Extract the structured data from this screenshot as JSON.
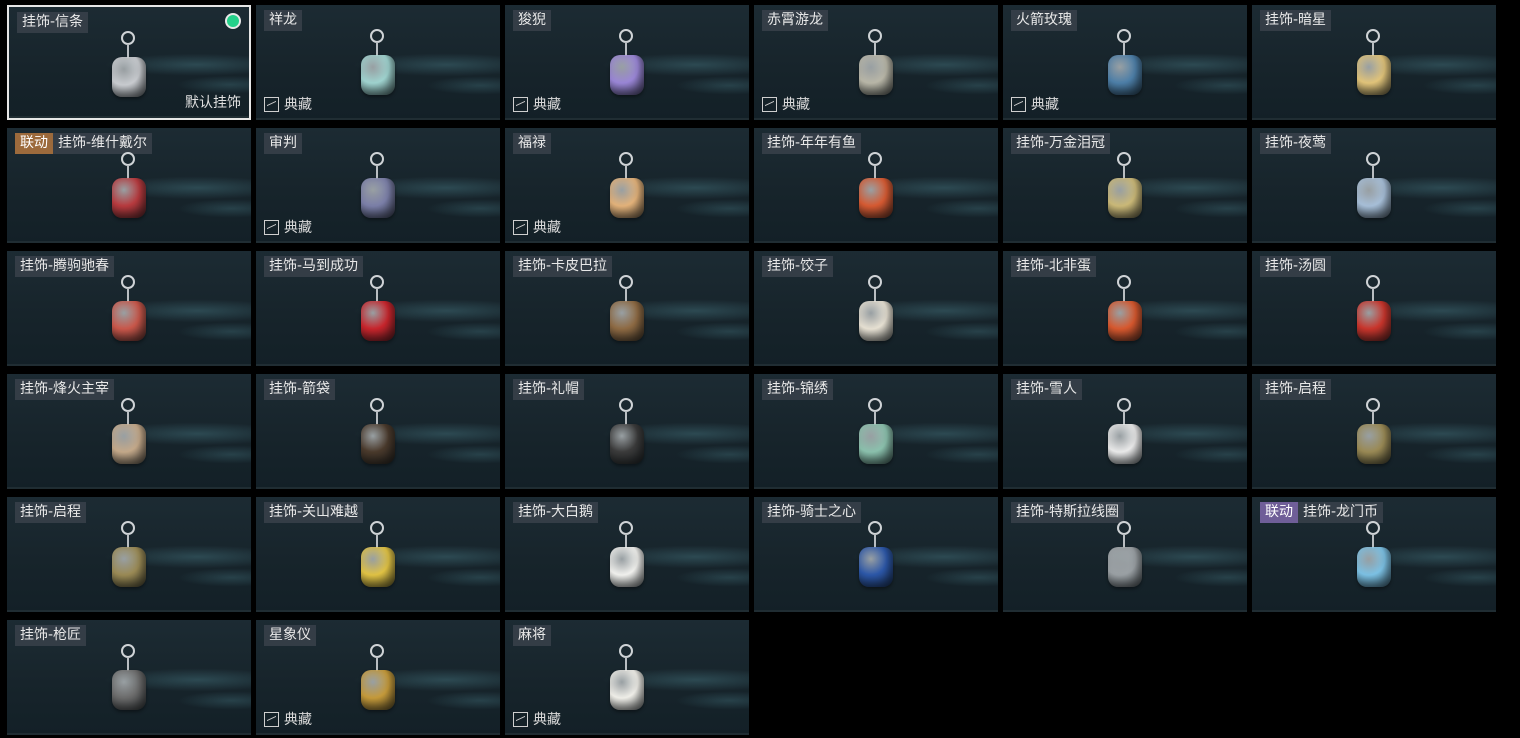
{
  "screen": {
    "collection_label": "典藏",
    "default_label": "默认挂饰"
  },
  "rows": [
    [
      {
        "name": "挂饰-信条",
        "selected": true,
        "equipped": true,
        "default": true,
        "collection": false,
        "color": "#c9ccd0",
        "icon": "creed-charm-icon"
      },
      {
        "name": "祥龙",
        "collection": true,
        "color": "#9fd3cf",
        "icon": "dragon-charm-icon"
      },
      {
        "name": "狻猊",
        "collection": true,
        "color": "#9a86d6",
        "icon": "lion-charm-icon"
      },
      {
        "name": "赤霄游龙",
        "collection": true,
        "color": "#b9b7a8",
        "icon": "robot-charm-icon"
      },
      {
        "name": "火箭玫瑰",
        "collection": true,
        "color": "#4d7fa8",
        "icon": "rocket-charm-icon"
      },
      {
        "name": "挂饰-暗星",
        "collection": false,
        "color": "#e1c47a",
        "icon": "dark-star-charm-icon"
      }
    ],
    [
      {
        "name": "挂饰-维什戴尔",
        "badge": "联动",
        "badge_color": "orange",
        "collection": false,
        "color": "#b73a3e",
        "icon": "card-charm-icon"
      },
      {
        "name": "审判",
        "collection": true,
        "color": "#7b7fa8",
        "icon": "tarot-charm-icon"
      },
      {
        "name": "福禄",
        "collection": true,
        "color": "#e3b27a",
        "icon": "gourd-charm-icon"
      },
      {
        "name": "挂饰-年年有鱼",
        "collection": false,
        "color": "#d65a32",
        "icon": "fish-charm-icon"
      },
      {
        "name": "挂饰-万金泪冠",
        "collection": false,
        "color": "#cbb978",
        "icon": "crown-charm-icon"
      },
      {
        "name": "挂饰-夜莺",
        "collection": false,
        "color": "#a7bfd8",
        "icon": "feather-charm-icon"
      }
    ],
    [
      {
        "name": "挂饰-腾驹驰春",
        "collection": false,
        "color": "#c9574a",
        "icon": "carriage-charm-icon"
      },
      {
        "name": "挂饰-马到成功",
        "collection": false,
        "color": "#c8252c",
        "icon": "horse-charm-icon"
      },
      {
        "name": "挂饰-卡皮巴拉",
        "collection": false,
        "color": "#8e6a43",
        "icon": "capybara-charm-icon"
      },
      {
        "name": "挂饰-饺子",
        "collection": false,
        "color": "#e7e1d3",
        "icon": "dumpling-charm-icon"
      },
      {
        "name": "挂饰-北非蛋",
        "collection": false,
        "color": "#d7582e",
        "icon": "shakshuka-charm-icon"
      },
      {
        "name": "挂饰-汤圆",
        "collection": false,
        "color": "#c9352c",
        "icon": "tangyuan-charm-icon"
      }
    ],
    [
      {
        "name": "挂饰-烽火主宰",
        "collection": false,
        "color": "#c4a98a",
        "icon": "triangle-emblem-charm-icon"
      },
      {
        "name": "挂饰-箭袋",
        "collection": false,
        "color": "#4a3a2c",
        "icon": "quiver-charm-icon"
      },
      {
        "name": "挂饰-礼帽",
        "collection": false,
        "color": "#3b3b3b",
        "icon": "fedora-charm-icon"
      },
      {
        "name": "挂饰-锦绣",
        "collection": false,
        "color": "#8bc1ad",
        "icon": "butterfly-charm-icon"
      },
      {
        "name": "挂饰-雪人",
        "collection": false,
        "color": "#eaeaea",
        "icon": "snowman-charm-icon"
      },
      {
        "name": "挂饰-启程",
        "collection": false,
        "color": "#9a8a55",
        "icon": "medallion-charm-icon"
      }
    ],
    [
      {
        "name": "挂饰-启程",
        "collection": false,
        "color": "#9a8a55",
        "icon": "medallion-charm-icon"
      },
      {
        "name": "挂饰-关山难越",
        "collection": false,
        "color": "#e0c244",
        "icon": "gold-bar-charm-icon"
      },
      {
        "name": "挂饰-大白鹅",
        "collection": false,
        "color": "#f1f1ee",
        "icon": "goose-charm-icon"
      },
      {
        "name": "挂饰-骑士之心",
        "collection": false,
        "color": "#2c57a8",
        "icon": "knight-cross-charm-icon"
      },
      {
        "name": "挂饰-特斯拉线圈",
        "collection": false,
        "color": "#9aa0a4",
        "icon": "tesla-coil-charm-icon"
      },
      {
        "name": "挂饰-龙门币",
        "badge": "联动",
        "badge_color": "purple",
        "collection": false,
        "color": "#7cc1e4",
        "icon": "coin-card-charm-icon"
      }
    ],
    [
      {
        "name": "挂饰-枪匠",
        "collection": false,
        "color": "#6b6b6b",
        "icon": "toolbox-charm-icon"
      },
      {
        "name": "星象仪",
        "collection": true,
        "color": "#c59a3a",
        "icon": "astrolabe-charm-icon"
      },
      {
        "name": "麻将",
        "collection": true,
        "color": "#f0efe9",
        "icon": "mahjong-charm-icon"
      }
    ]
  ]
}
